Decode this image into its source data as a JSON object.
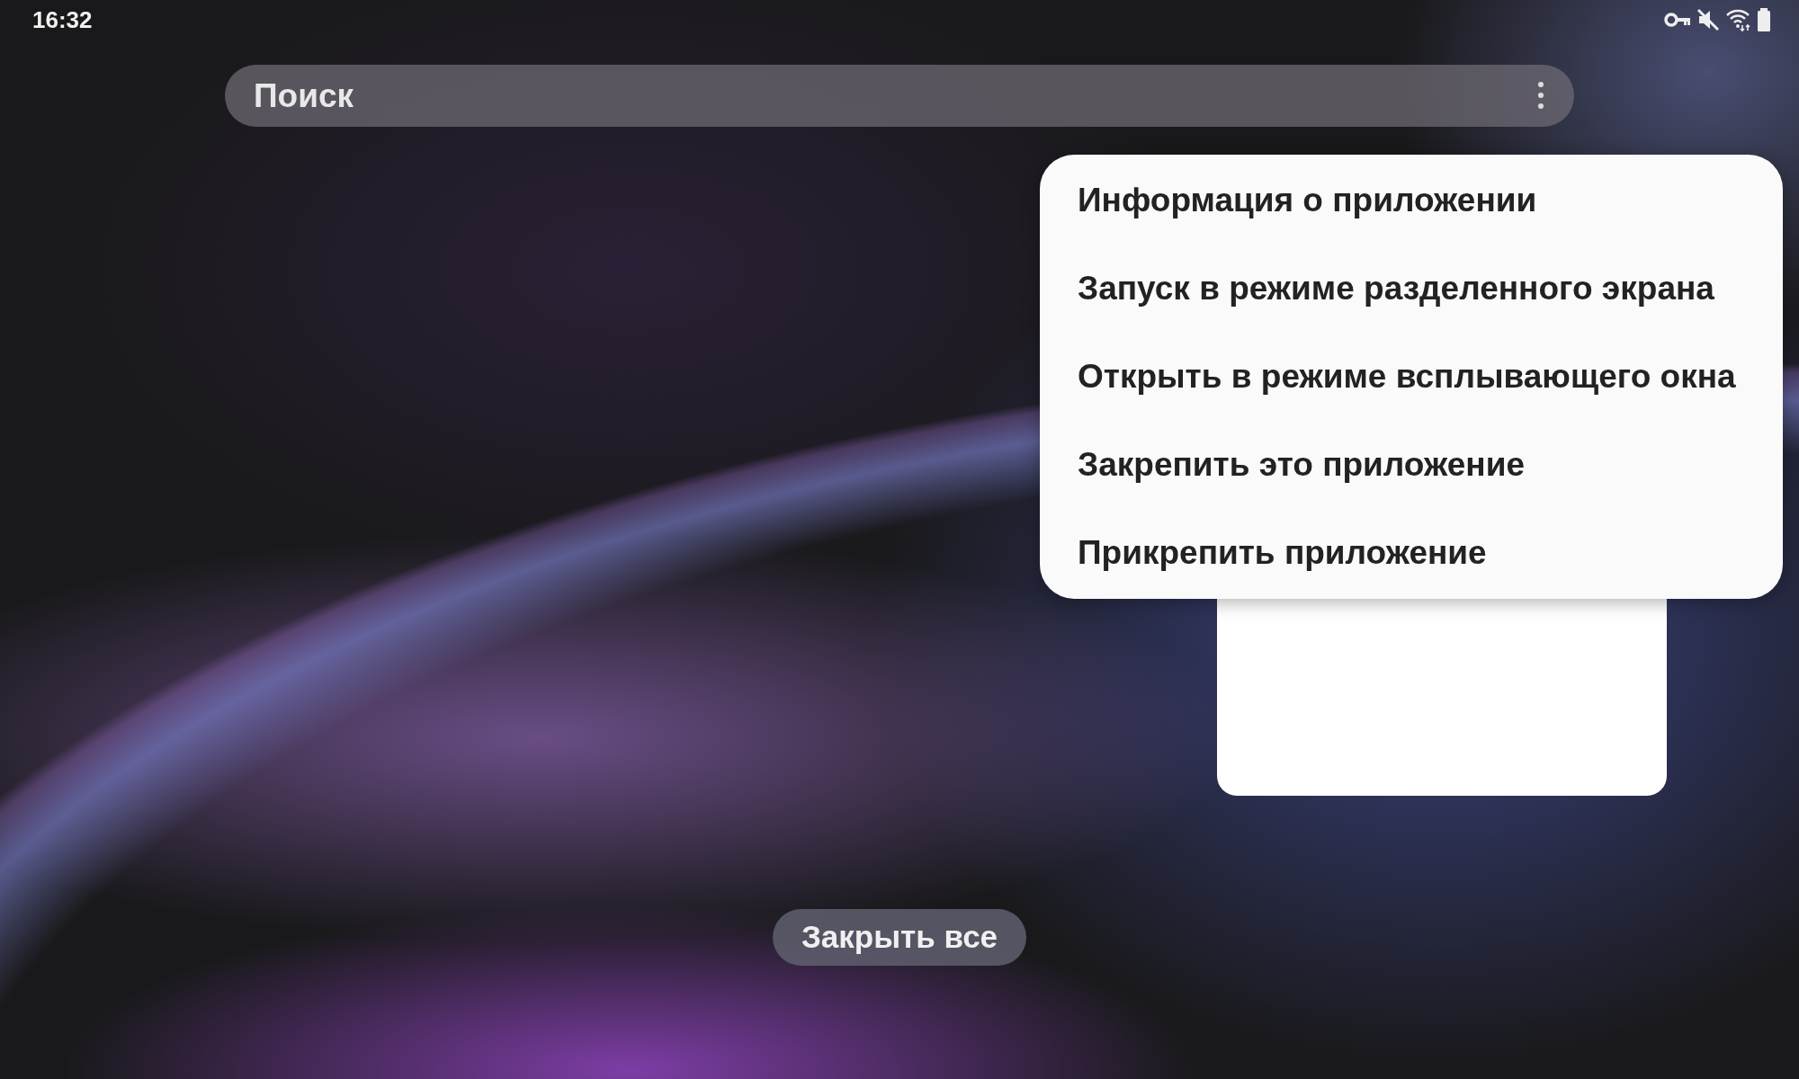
{
  "status_bar": {
    "time": "16:32"
  },
  "search": {
    "placeholder": "Поиск"
  },
  "context_menu": {
    "items": [
      {
        "label": "Информация о приложении"
      },
      {
        "label": "Запуск в режиме разделенного экрана"
      },
      {
        "label": "Открыть в режиме всплывающего окна"
      },
      {
        "label": "Закрепить это приложение"
      },
      {
        "label": "Прикрепить приложение"
      }
    ]
  },
  "close_all_button": {
    "label": "Закрыть все"
  }
}
